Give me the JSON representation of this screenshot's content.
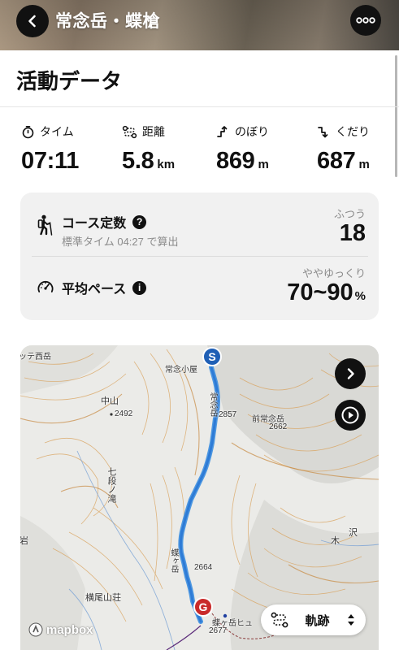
{
  "header": {
    "title": "常念岳・蝶槍",
    "back_icon": "chevron-left-icon",
    "more_icon": "ellipsis-icon"
  },
  "activity": {
    "section_title": "活動データ",
    "stats": [
      {
        "key": "time",
        "label": "タイム",
        "value": "07:11",
        "unit": "",
        "icon": "stopwatch-icon"
      },
      {
        "key": "distance",
        "label": "距離",
        "value": "5.8",
        "unit": "km",
        "icon": "route-icon"
      },
      {
        "key": "ascent",
        "label": "のぼり",
        "value": "869",
        "unit": "m",
        "icon": "ascent-arrow-icon"
      },
      {
        "key": "descent",
        "label": "くだり",
        "value": "687",
        "unit": "m",
        "icon": "descent-arrow-icon"
      }
    ]
  },
  "course_card": {
    "course_constant": {
      "title": "コース定数",
      "subtitle": "標準タイム 04:27 で算出",
      "rating_label": "ふつう",
      "value": "18",
      "icon": "hiker-icon"
    },
    "avg_pace": {
      "title": "平均ペース",
      "rating_label": "ややゆっくり",
      "value": "70~90",
      "unit": "%",
      "icon": "speedometer-icon"
    }
  },
  "map": {
    "start_marker": "S",
    "goal_marker": "G",
    "labels": {
      "tsubame": "ッテ西岳",
      "jonen_hut": "常念小屋",
      "jonendake": "常念岳",
      "peak_2857": "2857",
      "mae_jonen": "前常念岳",
      "peak_2662": "2662",
      "nakayama": "中山",
      "peak_2492": "2492",
      "nanadan": "七段ノ滝",
      "iwa": "岩",
      "sawa": "沢",
      "ki": "木",
      "chogatake": "蝶ヶ岳",
      "peak_2664": "2664",
      "yokoo": "横尾山荘",
      "cho_hut": "蝶ヶ岳ヒュ",
      "peak_2677": "2677"
    },
    "track_button_label": "軌跡",
    "attribution": "mapbox",
    "route_color": "#3d8fe0"
  }
}
